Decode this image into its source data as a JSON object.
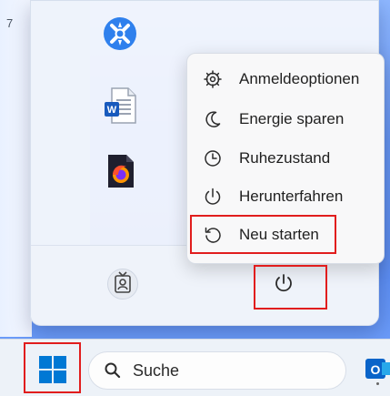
{
  "corner_label": "7",
  "power_menu": {
    "items": [
      {
        "label": "Anmeldeoptionen",
        "icon": "gear-icon"
      },
      {
        "label": "Energie sparen",
        "icon": "moon-icon"
      },
      {
        "label": "Ruhezustand",
        "icon": "clock-icon"
      },
      {
        "label": "Herunterfahren",
        "icon": "power-icon"
      },
      {
        "label": "Neu starten",
        "icon": "restart-icon"
      }
    ]
  },
  "pinned_apps": [
    {
      "icon": "app-x-icon"
    },
    {
      "icon": "word-document-icon"
    },
    {
      "icon": "firefox-file-icon"
    }
  ],
  "footer": {
    "user_icon": "user-badge-icon",
    "power_icon": "power-icon"
  },
  "taskbar": {
    "start_icon": "windows-logo-icon",
    "search_placeholder": "Suche",
    "pinned_app_icon": "outlook-icon"
  },
  "colors": {
    "highlight": "#e11d1d",
    "windows_blue": "#0078d4"
  }
}
